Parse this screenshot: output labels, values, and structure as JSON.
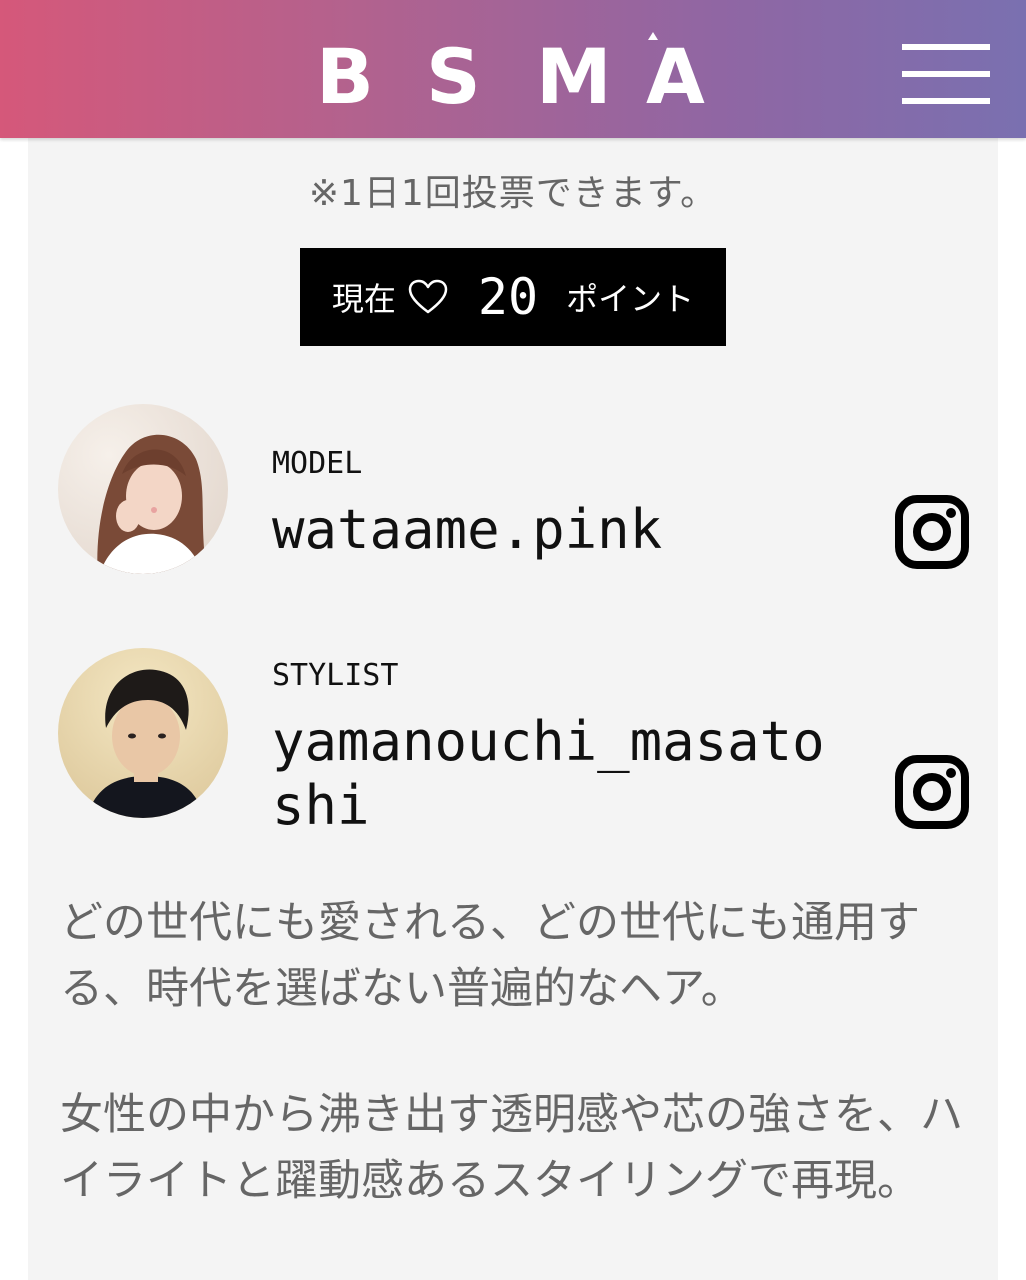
{
  "header": {
    "brand_letters": [
      "B",
      "S",
      "M",
      "A"
    ],
    "gradient": [
      "#d5587a",
      "#7a70b0"
    ],
    "menu_icon": "hamburger-menu-icon"
  },
  "vote": {
    "notice": "※1日1回投票できます。",
    "points_prefix": "現在",
    "points_icon": "heart-outline-icon",
    "points_value": "20",
    "points_suffix": "ポイント"
  },
  "credits": [
    {
      "role": "MODEL",
      "handle": "wataame.pink",
      "social_icon": "instagram-icon"
    },
    {
      "role": "STYLIST",
      "handle": "yamanouchi_masatoshi",
      "social_icon": "instagram-icon"
    }
  ],
  "description": [
    "どの世代にも愛される、どの世代にも通用する、時代を選ばない普遍的なヘア。",
    "女性の中から沸き出す透明感や芯の強さを、ハイライトと躍動感あるスタイリングで再現。"
  ],
  "colors": {
    "content_bg": "#f4f4f4",
    "points_box_bg": "#000000",
    "body_text": "#666666"
  }
}
